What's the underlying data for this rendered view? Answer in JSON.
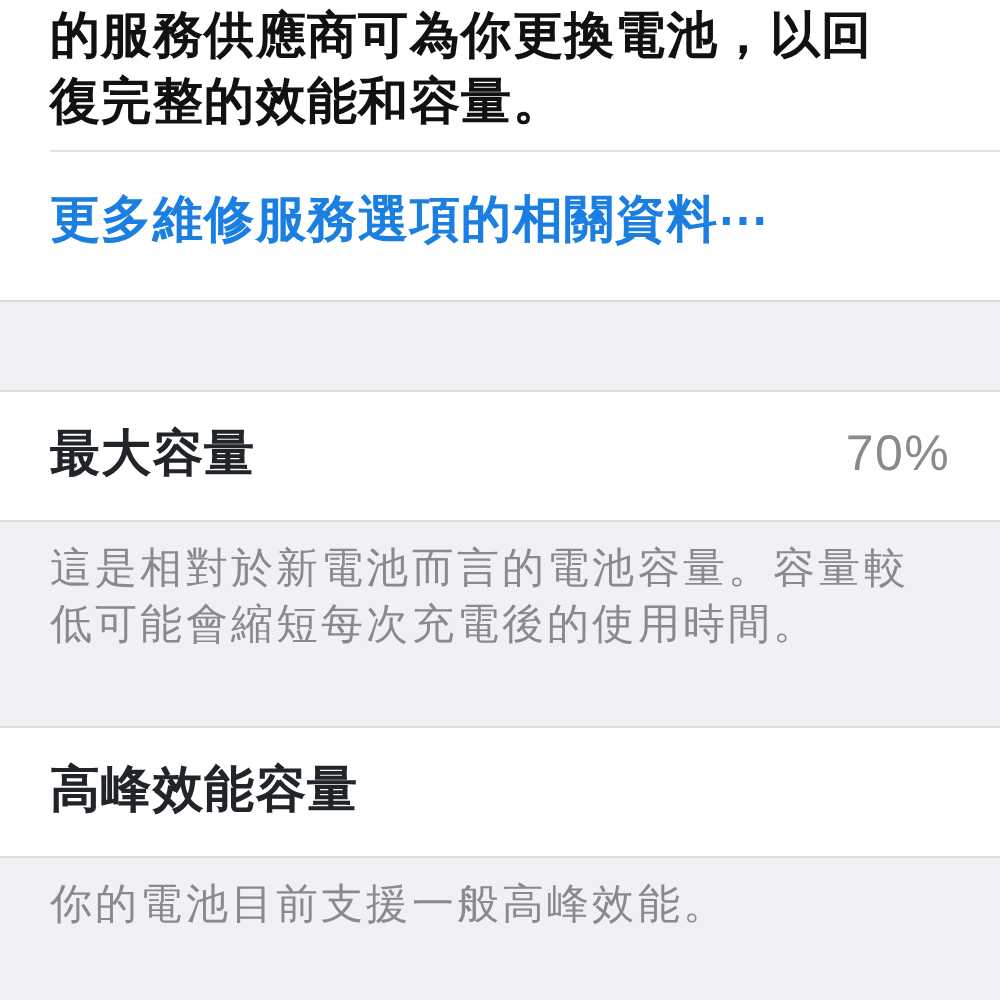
{
  "intro": {
    "text": "的服務供應商可為你更換電池，以回復完整的效能和容量。",
    "link": "更多維修服務選項的相關資料⋯"
  },
  "sections": [
    {
      "label": "最大容量",
      "value": "70%",
      "footer": "這是相對於新電池而言的電池容量。容量較低可能會縮短每次充電後的使用時間。"
    },
    {
      "label": "高峰效能容量",
      "footer": "你的電池目前支援一般高峰效能。"
    }
  ]
}
